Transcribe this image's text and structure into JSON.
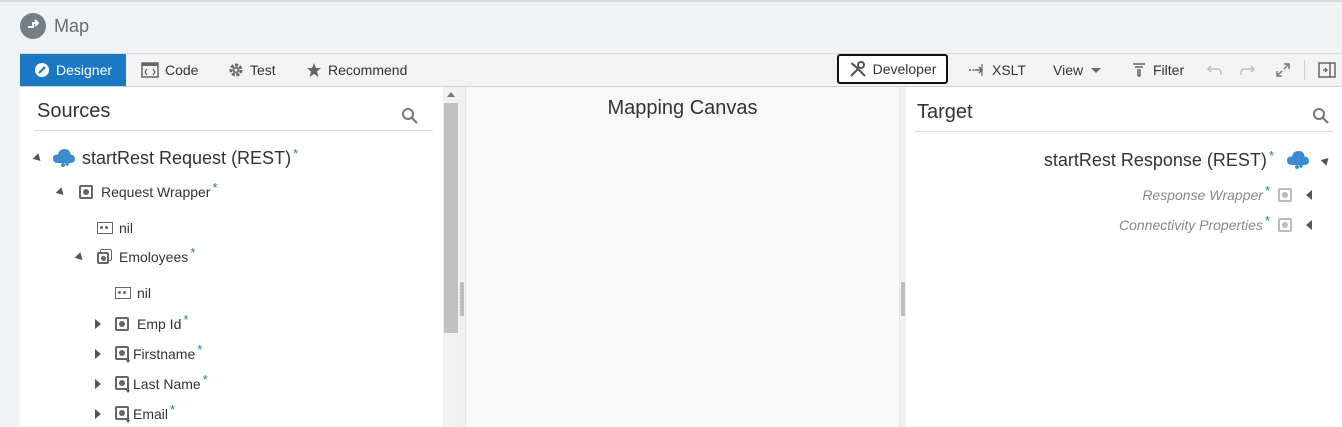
{
  "header": {
    "title": "Map",
    "icon": "map-icon"
  },
  "toolbar": {
    "designer": "Designer",
    "code": "Code",
    "test": "Test",
    "recommend": "Recommend",
    "developer": "Developer",
    "xslt": "XSLT",
    "view": "View",
    "filter": "Filter",
    "accent_color": "#1b79c4"
  },
  "sources": {
    "title": "Sources",
    "root": {
      "label": "startRest Request (REST)",
      "required": "*"
    },
    "items": [
      {
        "label": "Request Wrapper",
        "required": "*"
      },
      {
        "label": "nil"
      },
      {
        "label": "Emoloyees",
        "required": "*"
      },
      {
        "label": "nil"
      },
      {
        "label": "Emp Id",
        "required": "*"
      },
      {
        "label": "Firstname",
        "required": "*"
      },
      {
        "label": "Last Name",
        "required": "*"
      },
      {
        "label": "Email",
        "required": "*"
      }
    ]
  },
  "canvas": {
    "title": "Mapping Canvas"
  },
  "target": {
    "title": "Target",
    "root": {
      "label": "startRest Response (REST)",
      "required": "*"
    },
    "items": [
      {
        "label": "Response Wrapper",
        "required": "*"
      },
      {
        "label": "Connectivity Properties",
        "required": "*"
      }
    ]
  }
}
